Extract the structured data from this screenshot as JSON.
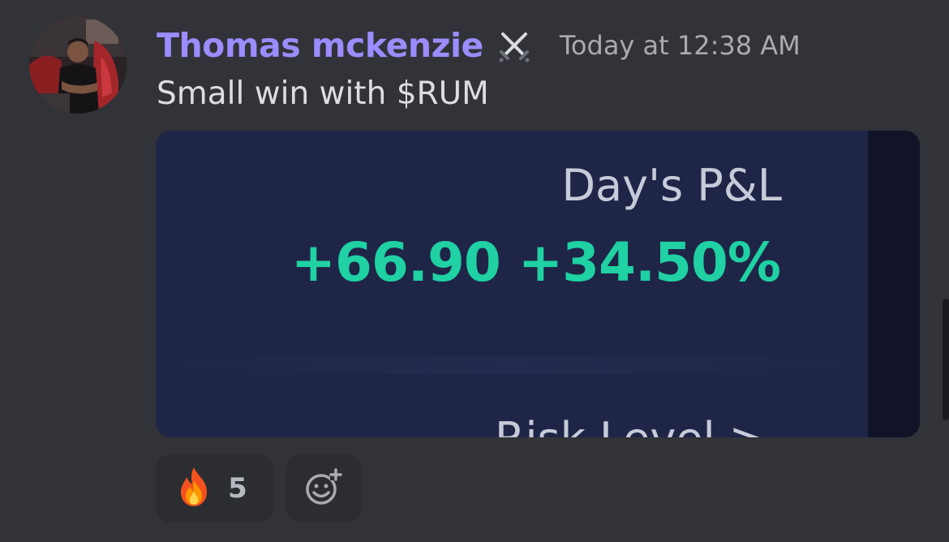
{
  "message": {
    "author": "Thomas mckenzie",
    "role_icon": "crossed-swords-icon",
    "timestamp": "Today at 12:38 AM",
    "text": "Small win with $RUM"
  },
  "attachment": {
    "label": "Day's P&L",
    "value": "+66.90 +34.50%",
    "cut_off_text": "Risk Level >"
  },
  "reactions": [
    {
      "emoji": "fire",
      "count": "5"
    },
    {
      "type": "add-reaction-icon"
    }
  ],
  "colors": {
    "username": "#9b8cff",
    "pnl_positive": "#1fd1a3",
    "background": "#313338"
  }
}
